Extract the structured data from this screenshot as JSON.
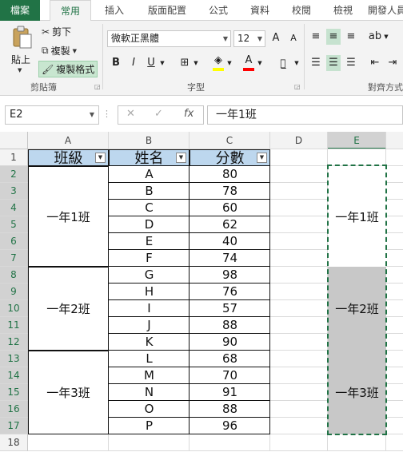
{
  "ribbon_tabs": [
    "檔案",
    "常用",
    "插入",
    "版面配置",
    "公式",
    "資料",
    "校閱",
    "檢視",
    "開發人員"
  ],
  "clipboard": {
    "paste": "貼上",
    "cut": "剪下",
    "copy": "複製",
    "format_painter": "複製格式",
    "group_label": "剪貼簿"
  },
  "font": {
    "name": "微軟正黑體",
    "size": "12",
    "grow": "A",
    "shrink": "A",
    "bold": "B",
    "italic": "I",
    "underline": "U",
    "group_label": "字型"
  },
  "alignment": {
    "group_label": "對齊方式"
  },
  "formula_bar": {
    "name_box": "E2",
    "formula": "一年1班"
  },
  "columns": [
    "A",
    "B",
    "C",
    "D",
    "E"
  ],
  "rows": [
    "1",
    "2",
    "3",
    "4",
    "5",
    "6",
    "7",
    "8",
    "9",
    "10",
    "11",
    "12",
    "13",
    "14",
    "15",
    "16",
    "17",
    "18"
  ],
  "headers": {
    "class": "班級",
    "name": "姓名",
    "score": "分數"
  },
  "classes": [
    "一年1班",
    "一年2班",
    "一年3班"
  ],
  "names": [
    "A",
    "B",
    "C",
    "D",
    "E",
    "F",
    "G",
    "H",
    "I",
    "J",
    "K",
    "L",
    "M",
    "N",
    "O",
    "P"
  ],
  "scores": [
    "80",
    "78",
    "60",
    "62",
    "40",
    "74",
    "98",
    "76",
    "57",
    "88",
    "90",
    "68",
    "70",
    "91",
    "88",
    "96"
  ],
  "colors": {
    "accent": "#217346",
    "header_fill": "#bdd7ee",
    "gray_fill": "#c8c8c8"
  }
}
